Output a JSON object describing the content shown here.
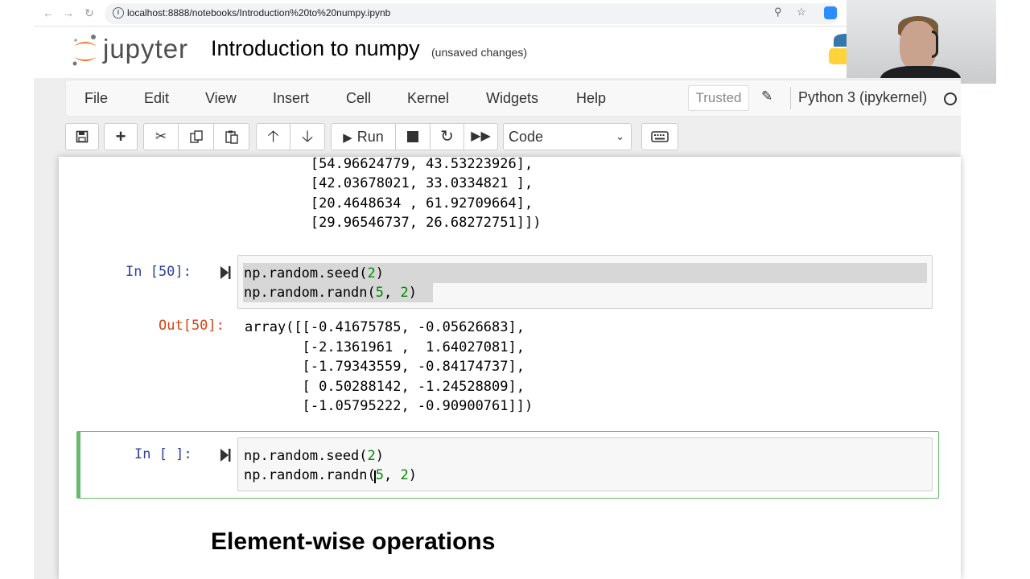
{
  "browser": {
    "url": "localhost:8888/notebooks/Introduction%20to%20numpy.ipynb",
    "back_icon": "arrow-left",
    "forward_icon": "arrow-right",
    "reload_icon": "reload"
  },
  "header": {
    "logo_text": "jupyter",
    "notebook_title": "Introduction to numpy",
    "save_status": "(unsaved changes)"
  },
  "menubar": {
    "items": [
      "File",
      "Edit",
      "View",
      "Insert",
      "Cell",
      "Kernel",
      "Widgets",
      "Help"
    ],
    "trusted_label": "Trusted",
    "kernel_name": "Python 3 (ipykernel)"
  },
  "toolbar": {
    "run_label": "Run",
    "cell_type": "Code"
  },
  "cells": {
    "prev_output_lines": [
      "        [54.96624779, 43.53223926],",
      "        [42.03678021, 33.0334821 ],",
      "        [20.4648634 , 61.92709664],",
      "        [29.96546737, 26.68272751]])"
    ],
    "cell50": {
      "prompt_in": "In [50]:",
      "code_lines": [
        "np.random.seed(2)",
        "np.random.randn(5, 2)"
      ],
      "prompt_out": "Out[50]:",
      "output_lines": [
        "array([[-0.41675785, -0.05626683],",
        "       [-2.1361961 ,  1.64027081],",
        "       [-1.79343559, -0.84174737],",
        "       [ 0.50288142, -1.24528809],",
        "       [-1.05795222, -0.90900761]])"
      ]
    },
    "active_cell": {
      "prompt_in": "In [ ]:",
      "code_lines": [
        "np.random.seed(2)",
        "np.random.randn(5, 2)"
      ]
    },
    "markdown_heading": "Element-wise operations"
  },
  "colors": {
    "prompt_in": "#303f9f",
    "prompt_out": "#d84315",
    "selected_cell_border": "#66bb6a",
    "number_literal": "#008800"
  }
}
